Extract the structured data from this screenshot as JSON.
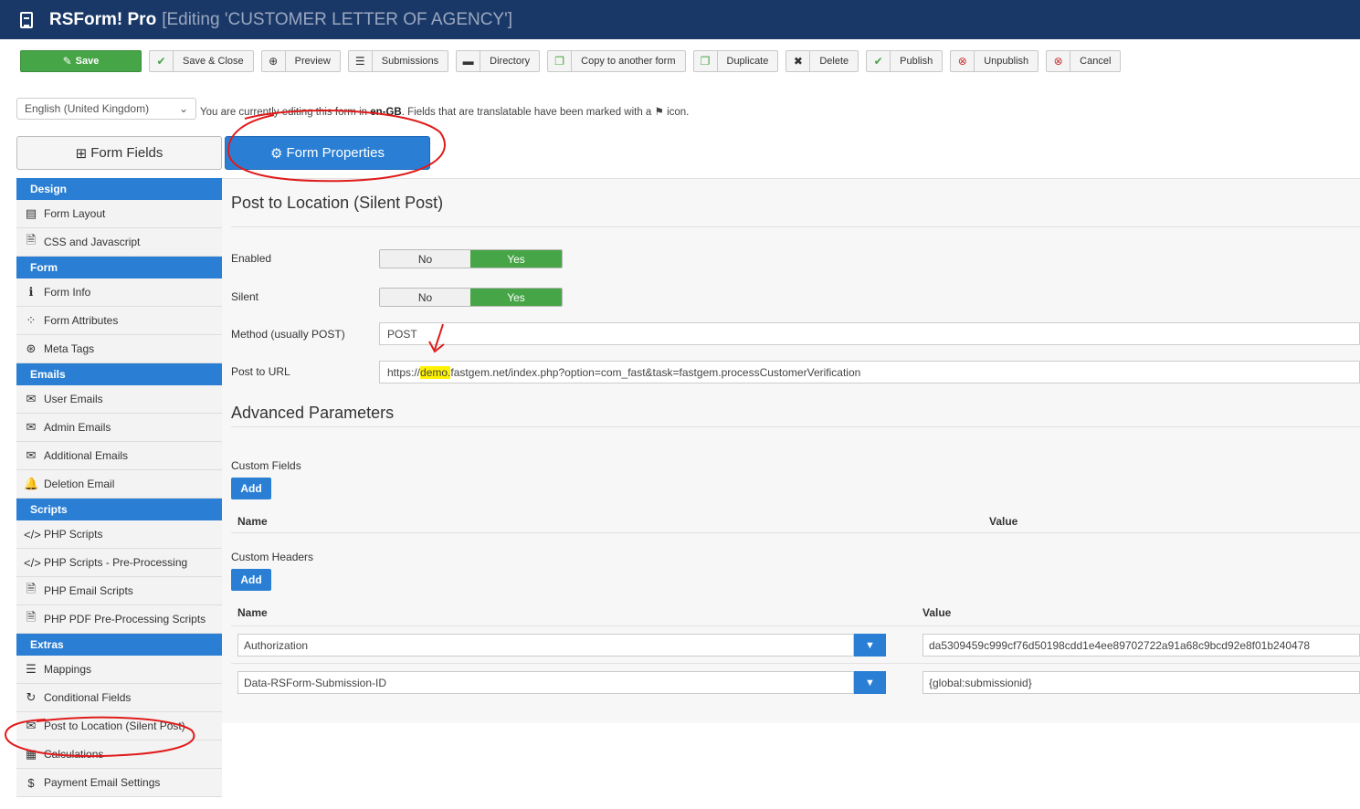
{
  "header": {
    "title": "RSForm! Pro",
    "subtitle": "[Editing 'CUSTOMER LETTER OF AGENCY']"
  },
  "toolbar": {
    "save": "Save",
    "save_close": "Save & Close",
    "preview": "Preview",
    "submissions": "Submissions",
    "directory": "Directory",
    "copy": "Copy to another form",
    "duplicate": "Duplicate",
    "delete": "Delete",
    "publish": "Publish",
    "unpublish": "Unpublish",
    "cancel": "Cancel"
  },
  "language": {
    "selected": "English (United Kingdom)",
    "note_prefix": "You are currently editing this form in",
    "note_lang": "en-GB",
    "note_suffix": ". Fields that are translatable have been marked with a",
    "note_end": "icon."
  },
  "tabs": {
    "fields": "Form Fields",
    "properties": "Form Properties"
  },
  "sidebar": {
    "design": "Design",
    "form_layout": "Form Layout",
    "css_js": "CSS and Javascript",
    "form": "Form",
    "form_info": "Form Info",
    "form_attributes": "Form Attributes",
    "meta_tags": "Meta Tags",
    "emails": "Emails",
    "user_emails": "User Emails",
    "admin_emails": "Admin Emails",
    "additional_emails": "Additional Emails",
    "deletion_email": "Deletion Email",
    "scripts": "Scripts",
    "php_scripts": "PHP Scripts",
    "php_pre": "PHP Scripts - Pre-Processing",
    "php_email": "PHP Email Scripts",
    "php_pdf": "PHP PDF Pre-Processing Scripts",
    "extras": "Extras",
    "mappings": "Mappings",
    "conditional": "Conditional Fields",
    "post_location": "Post to Location (Silent Post)",
    "calculations": "Calculations",
    "payment_email": "Payment Email Settings"
  },
  "main": {
    "section_title": "Post to Location (Silent Post)",
    "enabled_label": "Enabled",
    "silent_label": "Silent",
    "no": "No",
    "yes": "Yes",
    "method_label": "Method (usually POST)",
    "method_value": "POST",
    "url_label": "Post to URL",
    "url_prefix": "https://",
    "url_highlight": "demo.",
    "url_rest": "fastgem.net/index.php?option=com_fast&task=fastgem.processCustomerVerification",
    "advanced_title": "Advanced Parameters",
    "custom_fields": "Custom Fields",
    "custom_headers": "Custom Headers",
    "add": "Add",
    "name_col": "Name",
    "value_col": "Value",
    "headers": [
      {
        "name": "Authorization",
        "value": "da5309459c999cf76d50198cdd1e4ee89702722a91a68c9bcd92e8f01b240478"
      },
      {
        "name": "Data-RSForm-Submission-ID",
        "value": "{global:submissionid}"
      }
    ]
  }
}
